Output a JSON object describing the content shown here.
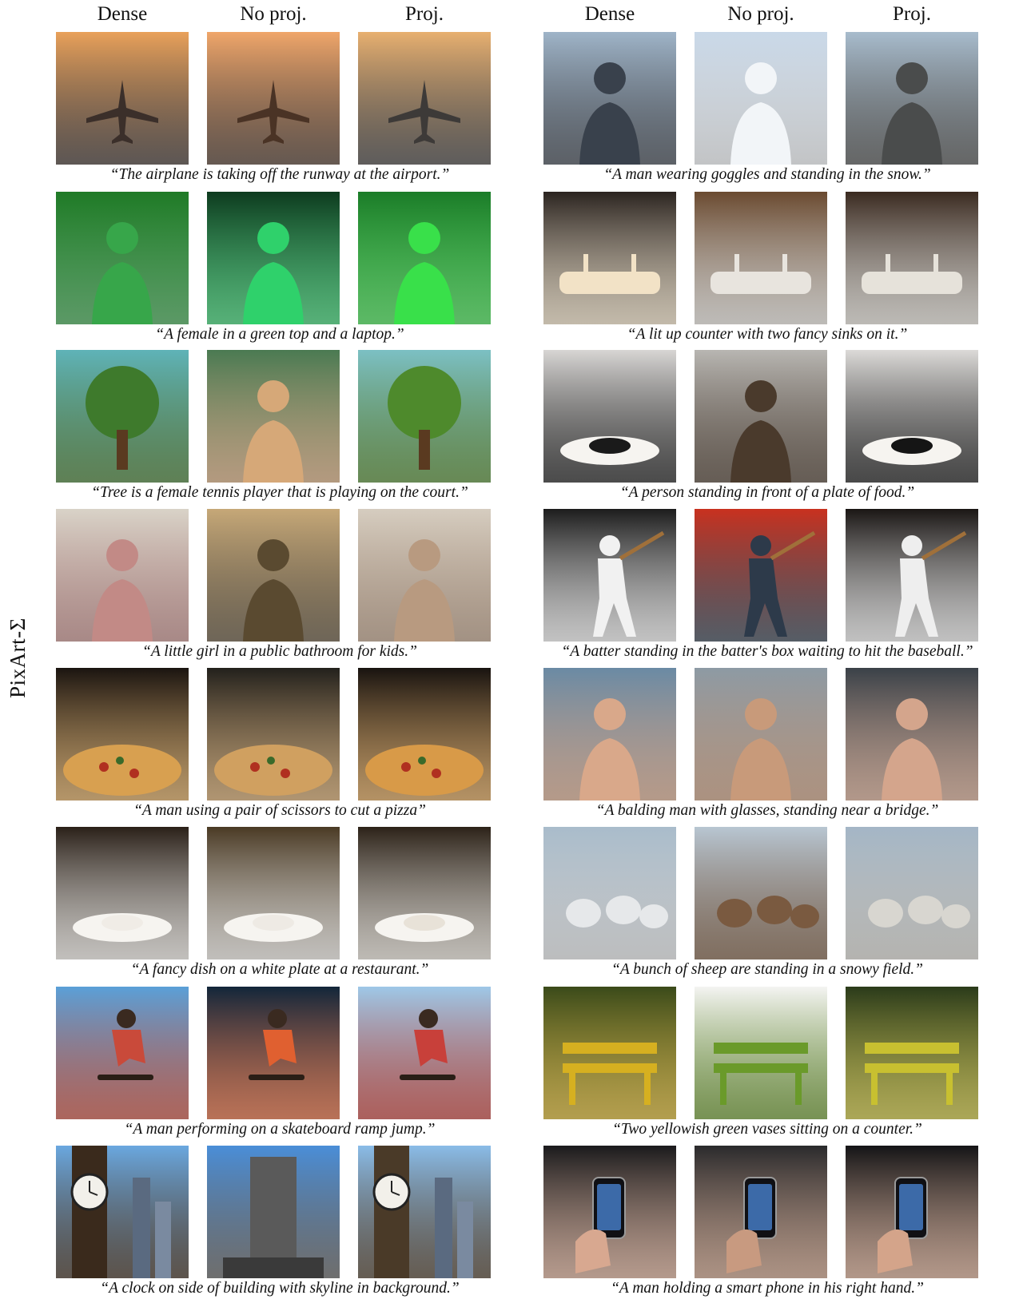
{
  "row_label": "PixArt-Σ",
  "column_headers": [
    "Dense",
    "No proj.",
    "Proj.",
    "Dense",
    "No proj.",
    "Proj."
  ],
  "panels": [
    {
      "caption": "“The airplane is taking off the runway at the airport.”",
      "images": [
        {
          "alt": "airplane on runway at sunset, front view",
          "icon": "airplane-icon",
          "colors": [
            "#e9a15a",
            "#3b2f2a"
          ]
        },
        {
          "alt": "airplane taking off over runway at sunset",
          "icon": "airplane-icon",
          "colors": [
            "#f0a66a",
            "#4a3325"
          ]
        },
        {
          "alt": "airplane on runway at sunset, centered",
          "icon": "airplane-icon",
          "colors": [
            "#e8b070",
            "#3d3a38"
          ]
        }
      ]
    },
    {
      "caption": "“A man wearing goggles and standing in the snow.”",
      "images": [
        {
          "alt": "man with goggles close up in snow",
          "icon": "person-icon",
          "colors": [
            "#9fb4c8",
            "#39414c"
          ]
        },
        {
          "alt": "man in black suit standing on snow",
          "icon": "person-icon",
          "colors": [
            "#c9d8e8",
            "#f2f5f8"
          ]
        },
        {
          "alt": "man with goggles and scarf in snowstorm",
          "icon": "person-icon",
          "colors": [
            "#a8bccd",
            "#4a4c4c"
          ]
        }
      ]
    },
    {
      "caption": "“A female in a green top and a laptop.”",
      "images": [
        {
          "alt": "woman in green sweater holding laptop",
          "icon": "person-icon",
          "colors": [
            "#1f7a26",
            "#37a64a"
          ]
        },
        {
          "alt": "woman lit by green neon light at desk",
          "icon": "person-icon",
          "colors": [
            "#0d3a1e",
            "#2fd16b"
          ]
        },
        {
          "alt": "woman in bright green top holding tablet",
          "icon": "person-icon",
          "colors": [
            "#1b7c28",
            "#39e04a"
          ]
        }
      ]
    },
    {
      "caption": "“A lit up counter with two fancy sinks on it.”",
      "images": [
        {
          "alt": "illuminated bathroom counter with sinks",
          "icon": "sink-icon",
          "colors": [
            "#2b2420",
            "#f2e2c6"
          ]
        },
        {
          "alt": "white kitchen counter with faucets",
          "icon": "sink-icon",
          "colors": [
            "#6a4a30",
            "#e8e4de"
          ]
        },
        {
          "alt": "curved lit counter with two sinks",
          "icon": "sink-icon",
          "colors": [
            "#3a2a20",
            "#e6e2da"
          ]
        }
      ]
    },
    {
      "caption": "“Tree is a female tennis player that is playing on the court.”",
      "images": [
        {
          "alt": "large tree with small tennis player",
          "icon": "tree-icon",
          "colors": [
            "#5fb3b8",
            "#3e7a2c"
          ]
        },
        {
          "alt": "woman with racket among leaves",
          "icon": "person-icon",
          "colors": [
            "#4a7a52",
            "#d6a878"
          ]
        },
        {
          "alt": "tree and tennis player on grass",
          "icon": "tree-icon",
          "colors": [
            "#7cc0c4",
            "#4e8a2c"
          ]
        }
      ]
    },
    {
      "caption": "“A person standing in front of a plate of food.”",
      "images": [
        {
          "alt": "person legs behind plate of food",
          "icon": "plate-icon",
          "colors": [
            "#d8d6d4",
            "#1a1a1a"
          ]
        },
        {
          "alt": "man in apron standing in kitchen",
          "icon": "person-icon",
          "colors": [
            "#b8b6b2",
            "#4a3a2c"
          ]
        },
        {
          "alt": "dark figure behind plate of food",
          "icon": "plate-icon",
          "colors": [
            "#dcdad8",
            "#151515"
          ]
        }
      ]
    },
    {
      "caption": "“A little girl in a public bathroom for kids.”",
      "images": [
        {
          "alt": "little girl portrait in bathroom",
          "icon": "person-icon",
          "colors": [
            "#d9d3c8",
            "#c28a86"
          ]
        },
        {
          "alt": "small children in vintage bathroom",
          "icon": "person-icon",
          "colors": [
            "#c6a878",
            "#5a4a30"
          ]
        },
        {
          "alt": "little girl in floral dress in bathroom",
          "icon": "person-icon",
          "colors": [
            "#d6cdc0",
            "#b89a80"
          ]
        }
      ]
    },
    {
      "caption": "“A batter standing in the batter's box waiting to hit the baseball.”",
      "images": [
        {
          "alt": "baseball batter swinging, dark background",
          "icon": "baseball-icon",
          "colors": [
            "#1c1c1c",
            "#f1f1f1"
          ]
        },
        {
          "alt": "batter swinging against red wall",
          "icon": "baseball-icon",
          "colors": [
            "#c9311f",
            "#2d3a4a"
          ]
        },
        {
          "alt": "baseball batter in white uniform swinging",
          "icon": "baseball-icon",
          "colors": [
            "#1a1614",
            "#eeeeee"
          ]
        }
      ]
    },
    {
      "caption": "“A man using a pair of scissors to cut a pizza”",
      "images": [
        {
          "alt": "hands cutting pizza with scissors",
          "icon": "pizza-icon",
          "colors": [
            "#1a1410",
            "#d8a050"
          ]
        },
        {
          "alt": "man in cap cutting pizza",
          "icon": "pizza-icon",
          "colors": [
            "#22201c",
            "#d0a060"
          ]
        },
        {
          "alt": "hands with scissors over pizza",
          "icon": "pizza-icon",
          "colors": [
            "#181310",
            "#d89a48"
          ]
        }
      ]
    },
    {
      "caption": "“A balding man with glasses, standing near a bridge.”",
      "images": [
        {
          "alt": "bald man with glasses near bridge",
          "icon": "person-icon",
          "colors": [
            "#6a8aa4",
            "#d9a88a"
          ]
        },
        {
          "alt": "man in hat and glasses on bridge",
          "icon": "person-icon",
          "colors": [
            "#8d9aa4",
            "#c89a7a"
          ]
        },
        {
          "alt": "bald man with glasses in tunnel frame",
          "icon": "person-icon",
          "colors": [
            "#3a4148",
            "#d4a58c"
          ]
        }
      ]
    },
    {
      "caption": "“A fancy dish on a white plate at a restaurant.”",
      "images": [
        {
          "alt": "gourmet dish on white plate",
          "icon": "plate-icon",
          "colors": [
            "#2a2018",
            "#f0ece6"
          ]
        },
        {
          "alt": "bowl of soup in restaurant",
          "icon": "plate-icon",
          "colors": [
            "#4a3a24",
            "#eeeae4"
          ]
        },
        {
          "alt": "plated dish with vegetables",
          "icon": "plate-icon",
          "colors": [
            "#2c2218",
            "#e8e2d8"
          ]
        }
      ]
    },
    {
      "caption": "“A bunch of sheep are standing in a snowy field.”",
      "images": [
        {
          "alt": "flock of sheep in snow",
          "icon": "sheep-icon",
          "colors": [
            "#a9bccb",
            "#e6e8ea"
          ]
        },
        {
          "alt": "brown sheep on snowy plain",
          "icon": "sheep-icon",
          "colors": [
            "#b8c6d2",
            "#7a5a40"
          ]
        },
        {
          "alt": "row of sheep in snowy field",
          "icon": "sheep-icon",
          "colors": [
            "#a4b6c6",
            "#d8d6d0"
          ]
        }
      ]
    },
    {
      "caption": "“A man performing on a skateboard ramp jump.”",
      "images": [
        {
          "alt": "skateboarder jumping over ramp",
          "icon": "skateboard-icon",
          "colors": [
            "#5aa0d8",
            "#c94a3a"
          ]
        },
        {
          "alt": "skateboarder under stage lights",
          "icon": "skateboard-icon",
          "colors": [
            "#12263a",
            "#e06030"
          ]
        },
        {
          "alt": "skateboarder jumping in park",
          "icon": "skateboard-icon",
          "colors": [
            "#9ec8e8",
            "#c8403a"
          ]
        }
      ]
    },
    {
      "caption": "“Two yellowish green vases sitting on a counter.”",
      "images": [
        {
          "alt": "wooden bench with yellow leaves",
          "icon": "bench-icon",
          "colors": [
            "#3a4a1a",
            "#d6b020"
          ]
        },
        {
          "alt": "green wooden bench on white",
          "icon": "bench-icon",
          "colors": [
            "#f4f4f2",
            "#6a9a2a"
          ]
        },
        {
          "alt": "yellow green bench in park",
          "icon": "bench-icon",
          "colors": [
            "#2a3a1a",
            "#c8c030"
          ]
        }
      ]
    },
    {
      "caption": "“A clock on side of building with skyline in background.”",
      "images": [
        {
          "alt": "wall clock with city skyline",
          "icon": "clock-icon",
          "colors": [
            "#6aa8e0",
            "#3a2a1c"
          ]
        },
        {
          "alt": "tall building under blue sky",
          "icon": "building-icon",
          "colors": [
            "#4a8ed8",
            "#5a5a5a"
          ]
        },
        {
          "alt": "clock tower beside skyline",
          "icon": "clock-icon",
          "colors": [
            "#8abce8",
            "#4a3a28"
          ]
        }
      ]
    },
    {
      "caption": "“A man holding a smart phone in his right hand.”",
      "images": [
        {
          "alt": "hands holding smartphone",
          "icon": "phone-icon",
          "colors": [
            "#1a1a1c",
            "#d8a890"
          ]
        },
        {
          "alt": "man looking at smartphone",
          "icon": "phone-icon",
          "colors": [
            "#2a2a2c",
            "#c89a80"
          ]
        },
        {
          "alt": "hand holding smartphone on dark",
          "icon": "phone-icon",
          "colors": [
            "#141416",
            "#d4a48a"
          ]
        }
      ]
    }
  ]
}
